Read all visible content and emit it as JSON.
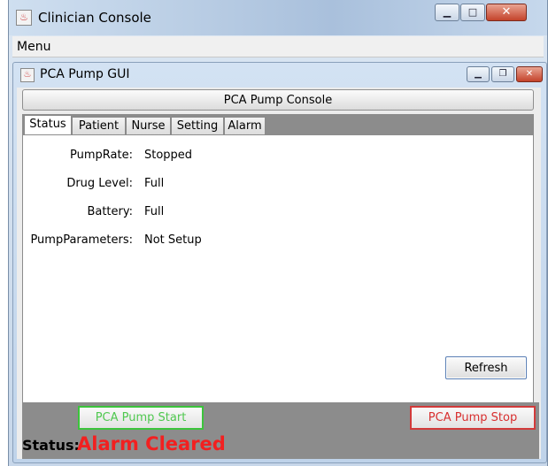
{
  "outer_window": {
    "title": "Clinician Console"
  },
  "menubar": {
    "menu_label": "Menu"
  },
  "inner_window": {
    "title": "PCA Pump GUI"
  },
  "console_button": "PCA Pump Console",
  "tabs": [
    {
      "label": "Status"
    },
    {
      "label": "Patient"
    },
    {
      "label": "Nurse"
    },
    {
      "label": "Setting"
    },
    {
      "label": "Alarm"
    }
  ],
  "status_fields": [
    {
      "label": "PumpRate:",
      "value": "Stopped"
    },
    {
      "label": "Drug Level:",
      "value": "Full"
    },
    {
      "label": "Battery:",
      "value": "Full"
    },
    {
      "label": "PumpParameters:",
      "value": "Not Setup"
    }
  ],
  "refresh_label": "Refresh",
  "start_label": "PCA Pump Start",
  "stop_label": "PCA Pump Stop",
  "status": {
    "label": "Status:",
    "value": "Alarm Cleared"
  },
  "colors": {
    "start": "#3cc43c",
    "stop": "#d23a3a",
    "status_value": "#f22020"
  }
}
